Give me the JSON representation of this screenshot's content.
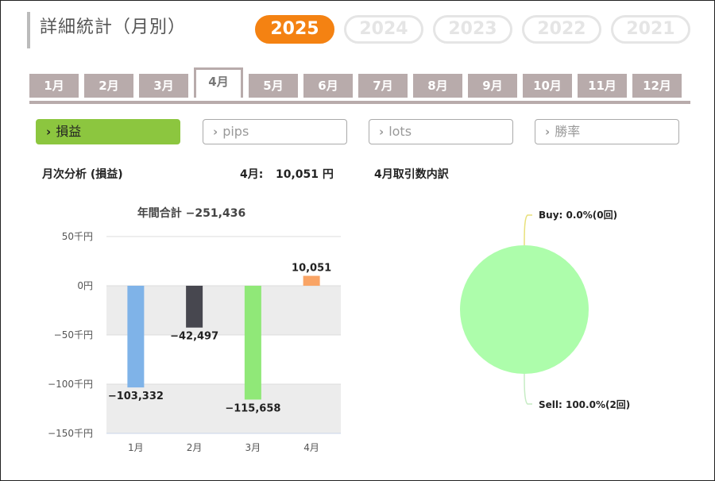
{
  "header": {
    "title": "詳細統計（月別）"
  },
  "years": [
    {
      "label": "2025",
      "active": true
    },
    {
      "label": "2024",
      "active": false
    },
    {
      "label": "2023",
      "active": false
    },
    {
      "label": "2022",
      "active": false
    },
    {
      "label": "2021",
      "active": false
    }
  ],
  "months": [
    {
      "label": "1月",
      "active": false
    },
    {
      "label": "2月",
      "active": false
    },
    {
      "label": "3月",
      "active": false
    },
    {
      "label": "4月",
      "active": true
    },
    {
      "label": "5月",
      "active": false
    },
    {
      "label": "6月",
      "active": false
    },
    {
      "label": "7月",
      "active": false
    },
    {
      "label": "8月",
      "active": false
    },
    {
      "label": "9月",
      "active": false
    },
    {
      "label": "10月",
      "active": false
    },
    {
      "label": "11月",
      "active": false
    },
    {
      "label": "12月",
      "active": false
    }
  ],
  "filters": [
    {
      "label": "損益",
      "active": true
    },
    {
      "label": "pips",
      "active": false
    },
    {
      "label": "lots",
      "active": false
    },
    {
      "label": "勝率",
      "active": false
    }
  ],
  "analysis": {
    "title": "月次分析 (損益)",
    "month_label": "4月:",
    "month_value": "10,051 円",
    "breakdown_title": "4月取引数内訳"
  },
  "icons": {
    "chevron": "chevron-right-icon"
  },
  "colors": {
    "accent": "#f48212",
    "filter_active": "#8cc63f",
    "tab": "#b8abab"
  },
  "chart_data": [
    {
      "type": "bar",
      "title": "年間合計 −251,436",
      "categories": [
        "1月",
        "2月",
        "3月",
        "4月"
      ],
      "values": [
        -103332,
        -42497,
        -115658,
        10051
      ],
      "data_labels": [
        "−103,332",
        "−42,497",
        "−115,658",
        "10,051"
      ],
      "colors": [
        "#7fb3e8",
        "#47474f",
        "#90e878",
        "#f9a465"
      ],
      "ylim": [
        -150000,
        50000
      ],
      "yticks": [
        50000,
        0,
        -50000,
        -100000,
        -150000
      ],
      "ytick_labels": [
        "50千円",
        "0円",
        "−50千円",
        "−100千円",
        "−150千円"
      ],
      "grid": true
    },
    {
      "type": "pie",
      "labels": [
        "Buy: 0.0%(0回)",
        "Sell: 100.0%(2回)"
      ],
      "values": [
        0,
        100
      ],
      "colors": [
        "#ffee88",
        "#adfdab"
      ]
    }
  ]
}
